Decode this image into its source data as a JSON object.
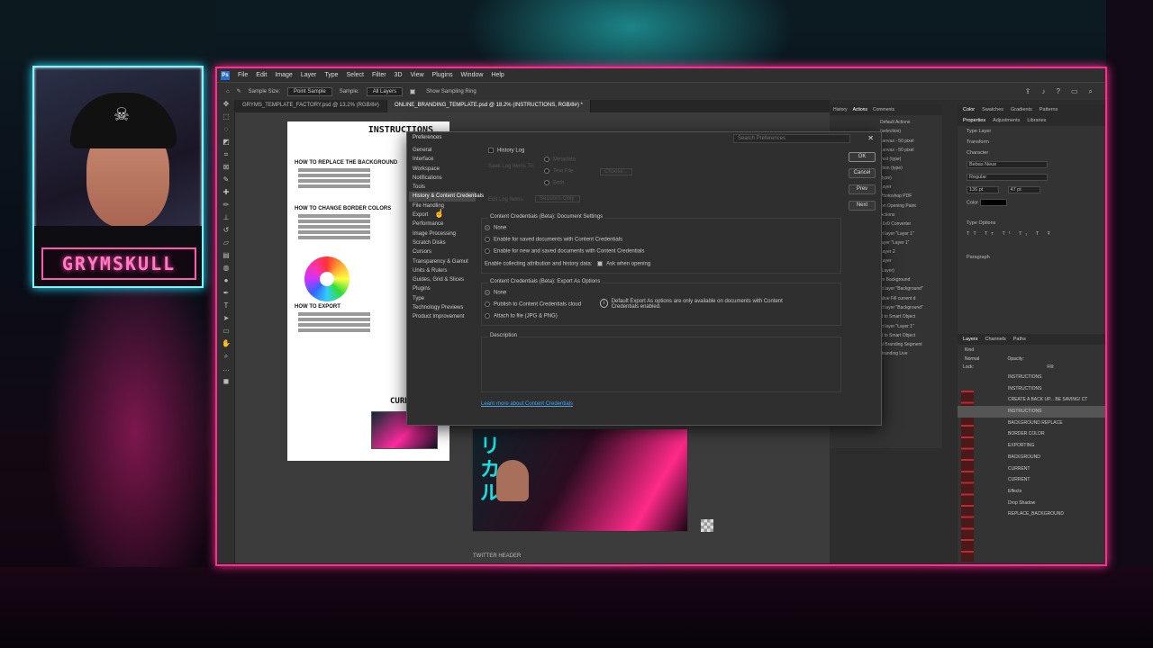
{
  "streamer": {
    "name": "GRYMSKULL"
  },
  "menu": [
    "File",
    "Edit",
    "Image",
    "Layer",
    "Type",
    "Select",
    "Filter",
    "3D",
    "View",
    "Plugins",
    "Window",
    "Help"
  ],
  "options_bar": {
    "sample_size_label": "Sample Size:",
    "sample_size_value": "Point Sample",
    "sample_label": "Sample:",
    "sample_value": "All Layers",
    "sampling_ring": "Show Sampling Ring"
  },
  "doc_tabs": [
    "GRYMS_TEMPLATE_FACTORY.psd @ 13.2% (RGB/8#)",
    "ONLINE_BRANDING_TEMPLATE.psd @ 18.2% (INSTRUCTIONS, RGB/8#) *"
  ],
  "instructions_doc": {
    "title": "INSTRUCTIONS",
    "sections": [
      "HOW TO REPLACE THE BACKGROUND",
      "HOW TO CHANGE BORDER COLORS",
      "HOW TO EXPORT"
    ],
    "current": "CURR"
  },
  "artwork_label": "TWITTER HEADER",
  "preferences": {
    "title": "Preferences",
    "search_placeholder": "Search Preferences",
    "nav": [
      "General",
      "Interface",
      "Workspace",
      "Notifications",
      "Tools",
      "History & Content Credentials",
      "File Handling",
      "Export",
      "Performance",
      "Image Processing",
      "Scratch Disks",
      "Cursors",
      "Transparency & Gamut",
      "Units & Rulers",
      "Guides, Grid & Slices",
      "Plugins",
      "Type",
      "Technology Previews",
      "Product Improvement"
    ],
    "history_log": "History Log",
    "save_log_items_to": "Save Log Items To:",
    "metadata": "Metadata",
    "text_file": "Text File",
    "choose": "Choose...",
    "both": "Both",
    "edit_log_items": "Edit Log Items:",
    "sessions_only": "Sessions Only",
    "doc_settings_title": "Content Credentials (Beta): Document Settings",
    "doc_opt_none": "None",
    "doc_opt_saved": "Enable for saved documents with Content Credentials",
    "doc_opt_new": "Enable for new and saved documents with Content Credentials",
    "collect_label": "Enable collecting attribution and history data:",
    "ask_when_opening": "Ask when opening",
    "export_title": "Content Credentials (Beta): Export As Options",
    "exp_opt_none": "None",
    "exp_opt_publish": "Publish to Content Credentials cloud",
    "exp_opt_attach": "Attach to file (JPG & PNG)",
    "export_info": "Default Export As options are only available on documents with Content Credentials enabled.",
    "description": "Description",
    "learn_more": "Learn more about Content Credentials",
    "buttons": {
      "ok": "OK",
      "cancel": "Cancel",
      "prev": "Prev",
      "next": "Next"
    }
  },
  "history_panel": {
    "tabs": [
      "History",
      "Actions",
      "Comments"
    ],
    "items": [
      "Default Actions",
      "(selection)",
      "canvas - 50 pixel",
      "canvas - 50 pixel",
      "Text (type)",
      "ction (type)",
      "(type)",
      "Layer",
      "Photoshop PDF",
      "ion Opening Paint",
      "Actions",
      "16x9 Converter",
      "ct layer \"Layer 1\"",
      "layer \"Layer 1\"",
      "Layer 2",
      "Layer",
      "(Layer)",
      "ve Background",
      "ct layer \"Background\"",
      "ative Fill current d",
      "ct layer \"Background\"",
      "rt to Smart Object",
      "ct layer \"Layer 1\"",
      "rt to Smart Object",
      "al Branding Segment",
      "Branding Live"
    ]
  },
  "properties_panel": {
    "tabs_top": [
      "Color",
      "Swatches",
      "Gradients",
      "Patterns"
    ],
    "tabs": [
      "Properties",
      "Adjustments",
      "Libraries"
    ],
    "layer_type": "Type Layer",
    "transform": "Transform",
    "character": "Character",
    "font": "Bebas Neue",
    "style": "Regular",
    "size": "136 pt",
    "leading": "47 pt",
    "type_options": "Type Options",
    "paragraph": "Paragraph",
    "color_label": "Color"
  },
  "layers_panel": {
    "tabs": [
      "Layers",
      "Channels",
      "Paths"
    ],
    "kind": "Kind",
    "mode": "Normal",
    "opacity_label": "Opacity:",
    "lock_label": "Lock:",
    "fill_label": "Fill:",
    "layers": [
      "INSTRUCTIONS",
      "INSTRUCTIONS",
      "CREATE A BACK UP... BE SAVING! CT",
      "INSTRUCTIONS",
      "BACKGROUND REPLACE",
      "BORDER COLOR",
      "EXPORTING",
      "BACKGROUND",
      "CURRENT",
      "CURRENT",
      "Effects",
      "Drop Shadow",
      "REPLACE_BACKGROUND"
    ],
    "selected_index": 3
  }
}
